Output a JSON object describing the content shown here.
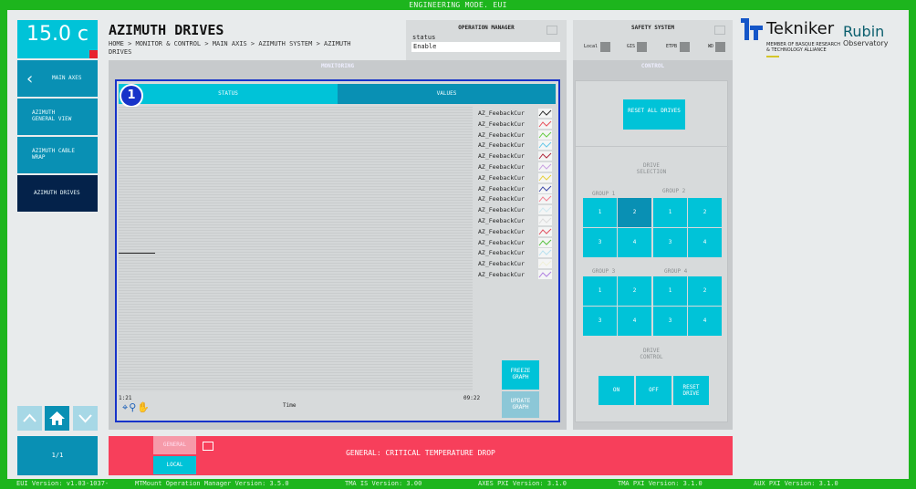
{
  "top_bar": {
    "mode_text": "ENGINEERING MODE. EUI"
  },
  "temperature": {
    "value": "15.0 c"
  },
  "nav": {
    "items": [
      {
        "label": "MAIN AXES"
      },
      {
        "label": "AZIMUTH GENERAL VIEW"
      },
      {
        "label": "AZIMUTH CABLE WRAP"
      },
      {
        "label": "AZIMUTH DRIVES"
      }
    ],
    "page_indicator": "1/1"
  },
  "header": {
    "title": "AZIMUTH DRIVES",
    "breadcrumb": "HOME > MONITOR & CONTROL > MAIN AXIS > AZIMUTH SYSTEM > AZIMUTH DRIVES"
  },
  "operation_manager": {
    "title": "OPERATION MANAGER",
    "status_label": "status",
    "status_value": "Enable"
  },
  "safety_system": {
    "title": "SAFETY SYSTEM",
    "items": [
      "Local",
      "GIS",
      "ETPB",
      "WD"
    ]
  },
  "logos": {
    "tekniker_name": "Tekniker",
    "tekniker_sub_1": "MEMBER OF BASQUE RESEARCH",
    "tekniker_sub_2": "& TECHNOLOGY ALLIANCE",
    "rubin_name": "Rubin",
    "rubin_sub": "Observatory"
  },
  "monitoring": {
    "title": "MONITORING",
    "badge": "1",
    "tabs": [
      "STATUS",
      "VALUES"
    ],
    "legend": [
      {
        "label": "AZ_FeebackCur",
        "color": "#2b2b2b"
      },
      {
        "label": "AZ_FeebackCur",
        "color": "#e8505b"
      },
      {
        "label": "AZ_FeebackCur",
        "color": "#66cc44"
      },
      {
        "label": "AZ_FeebackCur",
        "color": "#66c8e8"
      },
      {
        "label": "AZ_FeebackCur",
        "color": "#b02a3e"
      },
      {
        "label": "AZ_FeebackCur",
        "color": "#c8a0e0"
      },
      {
        "label": "AZ_FeebackCur",
        "color": "#e8d03c"
      },
      {
        "label": "AZ_FeebackCur",
        "color": "#3e4aa8"
      },
      {
        "label": "AZ_FeebackCur",
        "color": "#f08090"
      },
      {
        "label": "AZ_FeebackCur",
        "color": "#cfe8f0"
      },
      {
        "label": "AZ_FeebackCur",
        "color": "#dcdcdc"
      },
      {
        "label": "AZ_FeebackCur",
        "color": "#e05060"
      },
      {
        "label": "AZ_FeebackCur",
        "color": "#58c040"
      },
      {
        "label": "AZ_FeebackCur",
        "color": "#b8e0f0"
      },
      {
        "label": "AZ_FeebackCur",
        "color": "#f0f0d8"
      },
      {
        "label": "AZ_FeebackCur",
        "color": "#b080e0"
      }
    ],
    "x_tick_left": "1:21",
    "x_tick_right": "09:22",
    "x_label": "Time",
    "freeze_button": "FREEZE GRAPH",
    "update_button": "UPDATE GRAPH"
  },
  "control": {
    "title": "CONTROL",
    "reset_all": "RESET ALL DRIVES",
    "drive_selection": "DRIVE SELECTION",
    "groups": [
      {
        "label": "GROUP 1",
        "cells": [
          "1",
          "2",
          "3",
          "4"
        ],
        "selected": 1
      },
      {
        "label": "GROUP 2",
        "cells": [
          "1",
          "2",
          "3",
          "4"
        ],
        "selected": -1
      },
      {
        "label": "GROUP 3",
        "cells": [
          "1",
          "2",
          "3",
          "4"
        ],
        "selected": -1
      },
      {
        "label": "GROUP 4",
        "cells": [
          "1",
          "2",
          "3",
          "4"
        ],
        "selected": -1
      }
    ],
    "drive_control": "DRIVE CONTROL",
    "on": "ON",
    "off": "OFF",
    "reset_drive": "RESET DRIVE"
  },
  "alarm": {
    "tag_general": "GENERAL",
    "tag_local": "LOCAL",
    "message": "GENERAL: CRITICAL TEMPERATURE DROP"
  },
  "versions": {
    "eui": "EUI Version: v1.03-1037-",
    "mtmount": "MTMount Operation Manager Version: 3.5.0",
    "tma_is": "TMA IS Version: 3.00",
    "axes_pxi": "AXES PXI Version: 3.1.0",
    "tma_pxi": "TMA PXI Version: 3.1.0",
    "aux_pxi": "AUX PXI Version: 3.1.0"
  }
}
